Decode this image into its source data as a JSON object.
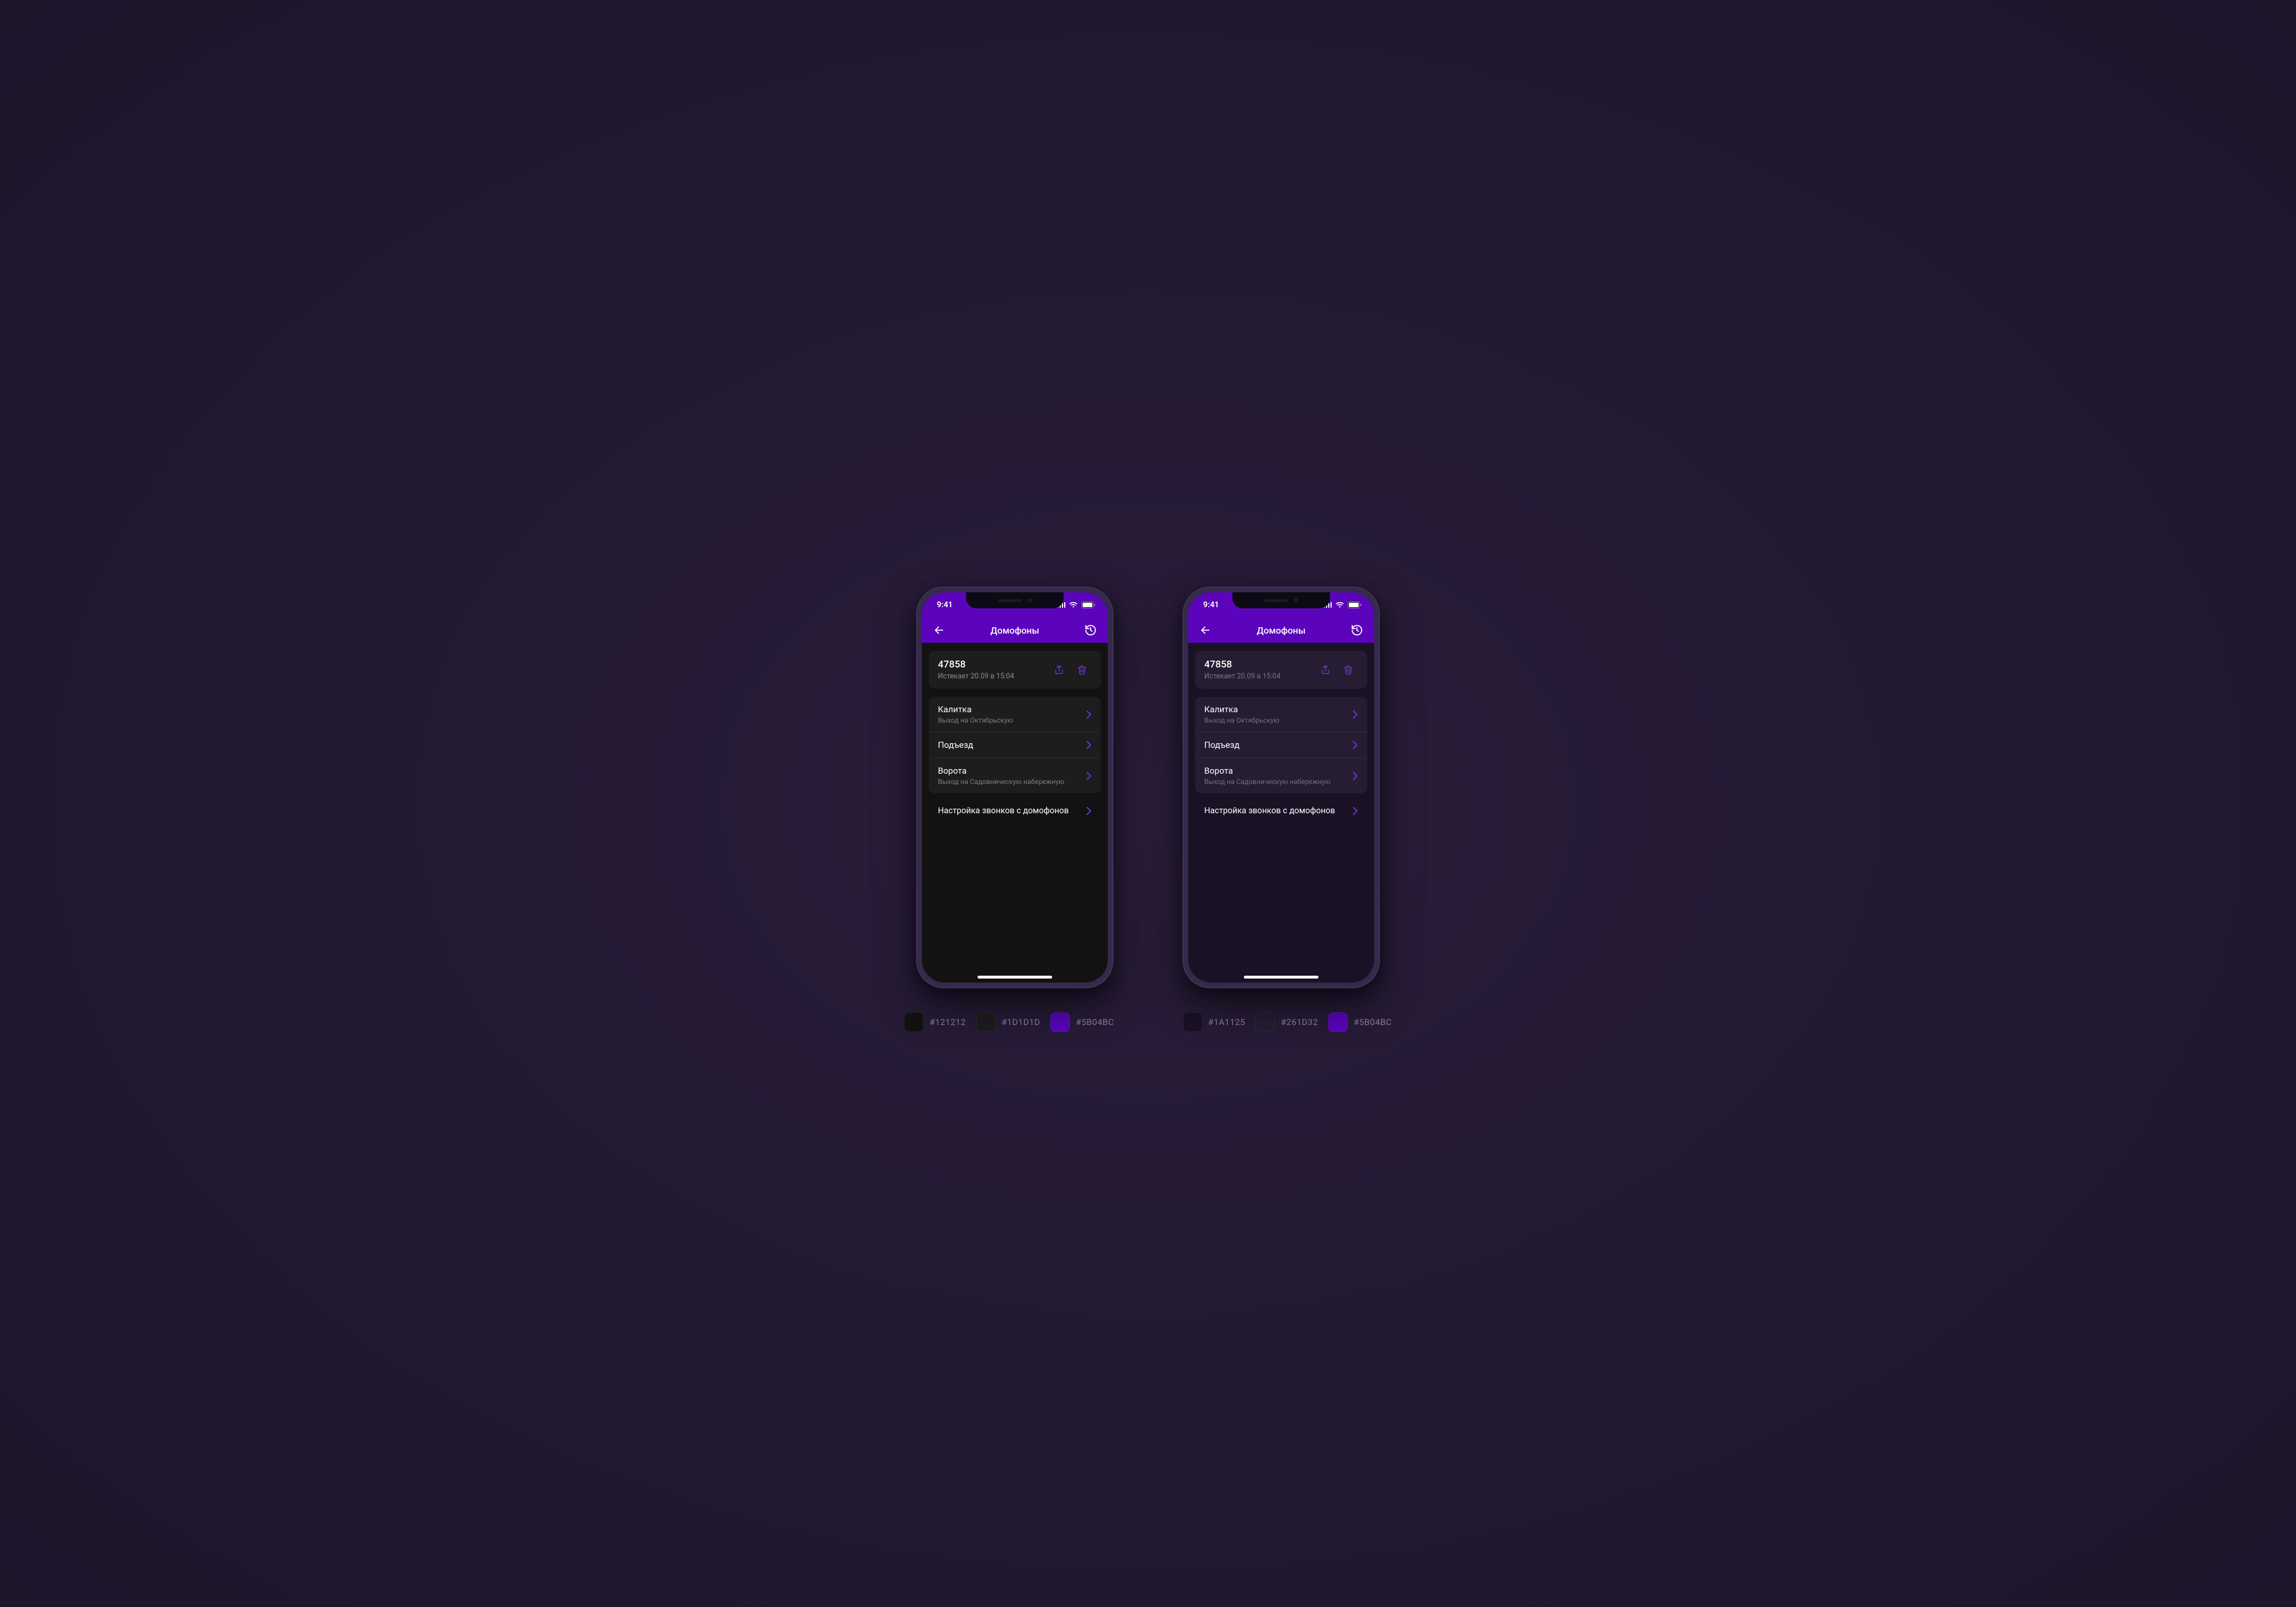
{
  "status": {
    "time": "9:41"
  },
  "nav": {
    "title": "Домофоны"
  },
  "code": {
    "value": "47858",
    "expires": "Истекает 20.09 в 15:04"
  },
  "entries": {
    "0": {
      "title": "Калитка",
      "sub": "Выход на Октябрьскую"
    },
    "1": {
      "title": "Подъезд"
    },
    "2": {
      "title": "Ворота",
      "sub": "Выход на Садовническую набережную"
    }
  },
  "settings": {
    "label": "Настройка звонков с домофонов"
  },
  "palettes": {
    "a": {
      "c1": "#121212",
      "c2": "#1D1D1D",
      "c3": "#5B04BC"
    },
    "b": {
      "c1": "#1A1125",
      "c2": "#261D32",
      "c3": "#5B04BC"
    }
  }
}
